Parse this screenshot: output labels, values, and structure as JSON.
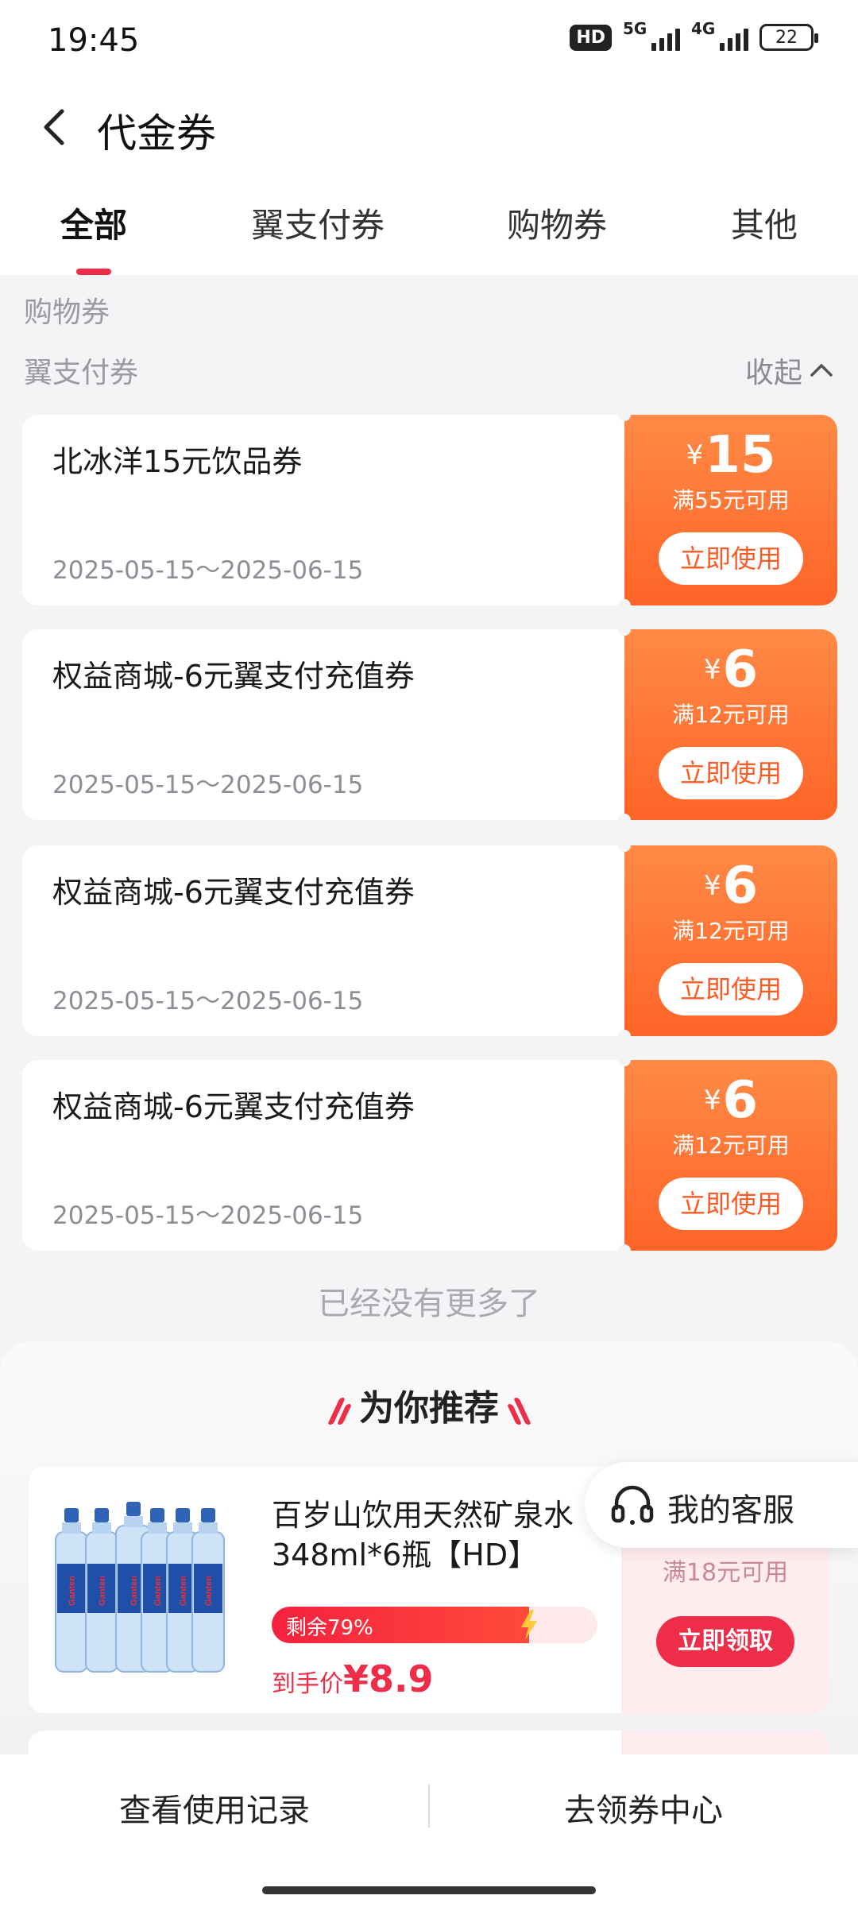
{
  "status_bar": {
    "time": "19:45",
    "hd_badge": "HD",
    "network_1": "5G",
    "network_2": "4G",
    "battery": "22"
  },
  "header": {
    "title": "代金券",
    "back_icon": "chevron-left-icon"
  },
  "tabs": [
    {
      "label": "全部",
      "active": true
    },
    {
      "label": "翼支付券",
      "active": false
    },
    {
      "label": "购物券",
      "active": false
    },
    {
      "label": "其他",
      "active": false
    }
  ],
  "sections": {
    "shopping_label": "购物券",
    "yizhifu_label": "翼支付券",
    "collapse_label": "收起"
  },
  "coupons": [
    {
      "name": "北冰洋15元饮品券",
      "date": "2025-05-15～2025-06-15",
      "currency": "¥",
      "amount": "15",
      "condition": "满55元可用",
      "button": "立即使用"
    },
    {
      "name": "权益商城-6元翼支付充值券",
      "date": "2025-05-15～2025-06-15",
      "currency": "¥",
      "amount": "6",
      "condition": "满12元可用",
      "button": "立即使用"
    },
    {
      "name": "权益商城-6元翼支付充值券",
      "date": "2025-05-15～2025-06-15",
      "currency": "¥",
      "amount": "6",
      "condition": "满12元可用",
      "button": "立即使用"
    },
    {
      "name": "权益商城-6元翼支付充值券",
      "date": "2025-05-15～2025-06-15",
      "currency": "¥",
      "amount": "6",
      "condition": "满12元可用",
      "button": "立即使用"
    }
  ],
  "no_more_text": "已经没有更多了",
  "recommend": {
    "title": "为你推荐",
    "product": {
      "name": "百岁山饮用天然矿泉水348ml*6瓶【HD】",
      "remaining_label": "剩余79%",
      "remaining_fraction": 0.79,
      "price_label": "到手价",
      "price_currency": "¥",
      "price_value": "8.9",
      "condition": "满18元可用",
      "claim_button": "立即领取",
      "bottle_label": "Ganten"
    }
  },
  "customer_service": {
    "label": "我的客服"
  },
  "bottom_bar": {
    "history_button": "查看使用记录",
    "coupon_center_button": "去领券中心"
  },
  "colors": {
    "accent_red": "#ee2d48",
    "coupon_orange_top": "#ff8a45",
    "coupon_orange_bottom": "#ff6428"
  }
}
